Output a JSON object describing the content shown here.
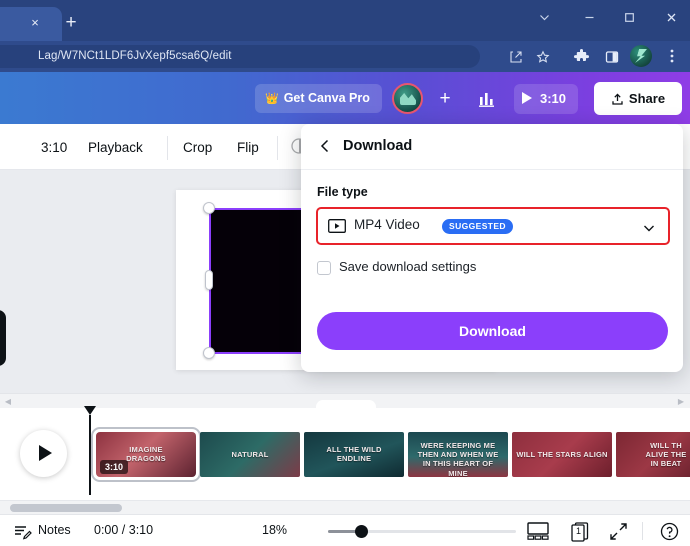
{
  "browser": {
    "tab_close_label": "×",
    "new_tab_label": "+",
    "url": "Lag/W7NCt1LDF6JvXepf5csa6Q/edit",
    "window_controls": {
      "chevron": "chevron-down",
      "minimize": "—",
      "maximize": "□",
      "close": "×"
    },
    "toolbar_icons": [
      "share-icon",
      "star-icon",
      "extensions-icon",
      "side-panel-icon",
      "profile-avatar",
      "more-menu-icon"
    ]
  },
  "canva_header": {
    "pro_button": "Get Canva Pro",
    "crown_icon": "crown-icon",
    "plus_label": "+",
    "analytics_icon": "bar-chart-icon",
    "duration": "3:10",
    "share_label": "Share",
    "gradient_start": "#3b7ad1",
    "gradient_end": "#8f3de6"
  },
  "edit_toolbar": {
    "scissors_icon": "scissors-icon",
    "duration": "3:10",
    "playback": "Playback",
    "crop": "Crop",
    "flip": "Flip"
  },
  "download_panel": {
    "back_icon": "chevron-left-icon",
    "title": "Download",
    "file_type_label": "File type",
    "file_type_value": "MP4 Video",
    "file_type_icon": "video-file-icon",
    "suggested_badge": "SUGGESTED",
    "chevron_icon": "chevron-down-icon",
    "save_settings_label": "Save download settings",
    "save_settings_checked": false,
    "download_button": "Download",
    "highlight_color": "#e8232a",
    "accent_color": "#8b3ffb",
    "badge_color": "#2a6df4"
  },
  "timeline": {
    "play_icon": "play-icon",
    "playhead_icon": "playhead-marker",
    "clips": [
      {
        "title": "IMAGINE\nDRAGONS",
        "duration": "3:10",
        "selected": true,
        "bg": "linear-gradient(135deg,#8d3240 0%,#c2636b 45%,#5c2230 100%)"
      },
      {
        "title": "NATURAL",
        "duration": "",
        "selected": false,
        "bg": "linear-gradient(135deg,#1d4a4d 0%,#2d6b66 50%,#7d3b48 100%)"
      },
      {
        "title": "ALL THE WILD\nENDLINE",
        "duration": "",
        "selected": false,
        "bg": "linear-gradient(160deg,#14383f 0%,#21555a 55%,#0f2a31 100%)"
      },
      {
        "title": "WERE KEEPING ME\nTHEN AND WHEN WE\nIN THIS HEART OF MINE",
        "duration": "",
        "selected": false,
        "bg": "linear-gradient(180deg,#1c4850 0%,#2e6a6b 55%,#8d3542 100%)"
      },
      {
        "title": "WILL THE STARS ALIGN",
        "duration": "",
        "selected": false,
        "bg": "linear-gradient(135deg,#8e2f3e 0%,#a83c4c 50%,#6d1f2c 100%)"
      },
      {
        "title": "WILL TH\nALIVE THE\nIN BEAT",
        "duration": "",
        "selected": false,
        "bg": "linear-gradient(135deg,#7c2733 0%,#9c3845 45%,#591a26 100%)"
      }
    ]
  },
  "statusbar": {
    "notes_icon": "notes-icon",
    "notes_label": "Notes",
    "time": "0:00 / 3:10",
    "zoom_level": "18%",
    "grid_icon": "grid-view-icon",
    "pages_icon": "pages-icon",
    "page_number": "1",
    "fullscreen_icon": "fullscreen-icon",
    "help_icon": "help-icon"
  }
}
